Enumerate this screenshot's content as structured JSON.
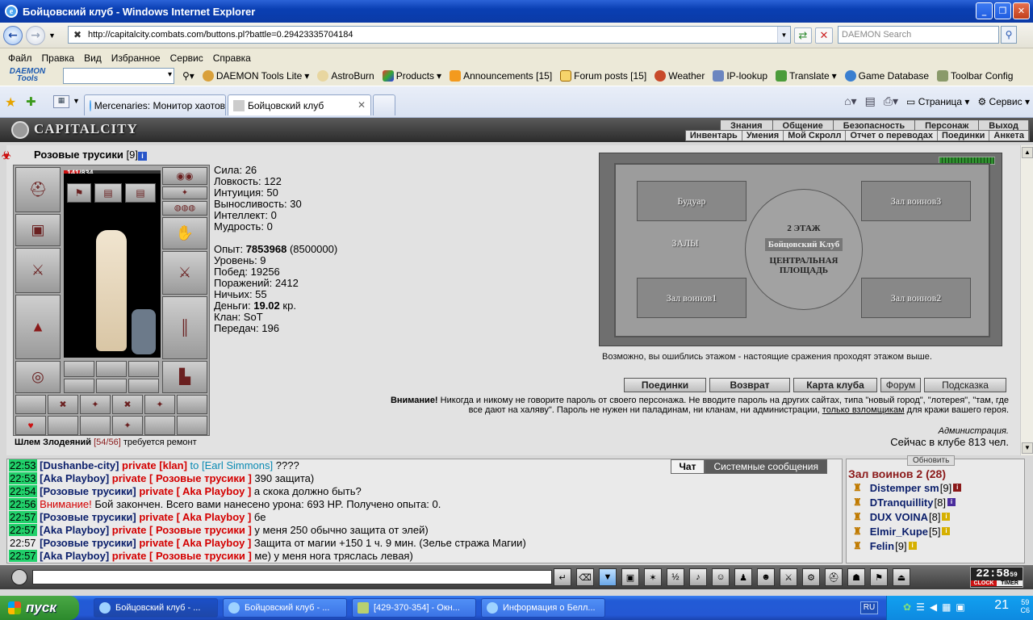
{
  "window": {
    "title": "Бойцовский клуб - Windows Internet Explorer"
  },
  "address": {
    "url": "http://capitalcity.combats.com/buttons.pl?battle=0.29423335704184",
    "search_placeholder": "DAEMON Search"
  },
  "menu": [
    "Файл",
    "Правка",
    "Вид",
    "Избранное",
    "Сервис",
    "Справка"
  ],
  "toolbar": {
    "logo_line1": "DAEMON",
    "logo_line2": "Tools",
    "items": [
      "DAEMON Tools Lite",
      "AstroBurn",
      "Products",
      "Announcements [15]",
      "Forum posts [15]",
      "Weather",
      "IP-lookup",
      "Translate",
      "Game Database",
      "Toolbar Config"
    ]
  },
  "tabs": [
    {
      "label": "Mercenaries: Монитор хаотов"
    },
    {
      "label": "Бойцовский клуб"
    }
  ],
  "commandbar": {
    "page": "Страница",
    "tools": "Сервис"
  },
  "site": {
    "logo": "CAPITALCITY",
    "topnav": [
      "Знания",
      "Общение",
      "Безопасность",
      "Персонаж",
      "Выход"
    ],
    "subnav": [
      "Инвентарь",
      "Умения",
      "Мой Скролл",
      "Отчет о переводах",
      "Поединки",
      "Анкета"
    ]
  },
  "character": {
    "name": "Розовые трусики",
    "level": "[9]",
    "hp_current": 141,
    "hp_max": 834,
    "hp_text": "141/834",
    "item_name": "Шлем Злодеяний",
    "item_durability": "[54/56]",
    "item_note": "требуется ремонт",
    "stats": [
      {
        "label": "Сила:",
        "value": "26"
      },
      {
        "label": "Ловкость:",
        "value": "122"
      },
      {
        "label": "Интуиция:",
        "value": "50"
      },
      {
        "label": "Выносливость:",
        "value": "30"
      },
      {
        "label": "Интеллект:",
        "value": "0"
      },
      {
        "label": "Мудрость:",
        "value": "0"
      }
    ],
    "exp_label": "Опыт:",
    "exp_value": "7853968",
    "exp_next": "(8500000)",
    "level_line": "Уровень: 9",
    "wins": "Побед: 19256",
    "losses": "Поражений: 2412",
    "draws": "Ничьих: 55",
    "money_label": "Деньги:",
    "money_value": "19.02",
    "money_unit": "кр.",
    "clan": "Клан: SoT",
    "transfers": "Передач: 196"
  },
  "map": {
    "rooms": [
      "Будуар",
      "Зал воинов3",
      "2 ЭТАЖ",
      "Бойцовский Клуб",
      "ЗАЛЫ",
      "ЦЕНТРАЛЬНАЯ ПЛОЩАДЬ",
      "Зал воинов1",
      "Зал воинов2"
    ],
    "note": "Возможно, вы ошиблись этажом - настоящие сражения проходят этажом выше."
  },
  "actions": [
    "Поединки",
    "Возврат",
    "Карта клуба",
    "Форум",
    "Подсказка"
  ],
  "warning": {
    "bold": "Внимание!",
    "text1": " Никогда и никому не говорите пароль от своего персонажа. Не вводите пароль на других сайтах, типа \"новый город\", \"лотерея\", \"там, где все дают на халяву\". Пароль не нужен ни паладинам, ни кланам, ни администрации, ",
    "link": "только взломщикам",
    "text2": " для кражи вашего героя.",
    "admin": "Администрация.",
    "online": "Сейчас в клубе 813 чел."
  },
  "chat": {
    "tabs": [
      "Чат",
      "Системные сообщения"
    ],
    "lines": [
      {
        "time": "22:53",
        "nick": "[Dushanbe-city]",
        "priv": " private [klan]",
        "to": " to [Earl Simmons]",
        "text": " ????"
      },
      {
        "time": "22:53",
        "nick": "[Aka Playboy]",
        "priv": " private [ Розовые трусики ]",
        "to": "",
        "text": " 390 защита)"
      },
      {
        "time": "22:54",
        "nick": "[Розовые трусики]",
        "priv": " private [ Aka Playboy ]",
        "to": "",
        "text": " а скока должно быть?"
      },
      {
        "time": "22:56",
        "nick": "",
        "priv": "",
        "to": "",
        "warn": "Внимание!",
        "text": " Бой закончен. Всего вами нанесено урона: 693 HP. Получено опыта: 0."
      },
      {
        "time": "22:57",
        "nick": "[Розовые трусики]",
        "priv": " private [ Aka Playboy ]",
        "to": "",
        "text": " бе"
      },
      {
        "time": "22:57",
        "nick": "[Aka Playboy]",
        "priv": " private [ Розовые трусики ]",
        "to": "",
        "text": " у меня 250 обычно защита от элей)"
      },
      {
        "time": "22:57",
        "nick": "[Розовые трусики]",
        "priv": " private [ Aka Playboy ]",
        "to": "",
        "text": " Защита от магии +150 1 ч. 9 мин. (Зелье стража Магии)"
      },
      {
        "time": "22:57",
        "nick": "[Aka Playboy]",
        "priv": " private [ Розовые трусики ]",
        "to": "",
        "text": " ме) у меня нога тряслась левая)"
      }
    ]
  },
  "room_list": {
    "refresh": "Обновить",
    "title": "Зал воинов 2 (28)",
    "users": [
      {
        "nick": "Distemper sm",
        "lvl": "[9]"
      },
      {
        "nick": "DTranquillity",
        "lvl": "[8]"
      },
      {
        "nick": "DUX VOINA",
        "lvl": "[8]"
      },
      {
        "nick": "Elmir_Kupe",
        "lvl": "[5]"
      },
      {
        "nick": "Felin",
        "lvl": "[9]"
      }
    ]
  },
  "clock": {
    "time": "22:58",
    "sec": "59",
    "clock_label": "CLOCK",
    "timer_label": "TIMER"
  },
  "taskbar": {
    "start": "пуск",
    "tasks": [
      "Бойцовский клуб - ...",
      "Бойцовский клуб - ...",
      "[429-370-354] - Окн...",
      "Информация о Белл..."
    ],
    "lang": "RU",
    "time": "21",
    "time_sup1": "59",
    "time_sup2": "C6"
  },
  "colors": {
    "title_blue": "#0a3fb3",
    "chat_time_green": "#21d06a",
    "private_red": "#d40000",
    "nick_blue": "#0b1f6b"
  }
}
